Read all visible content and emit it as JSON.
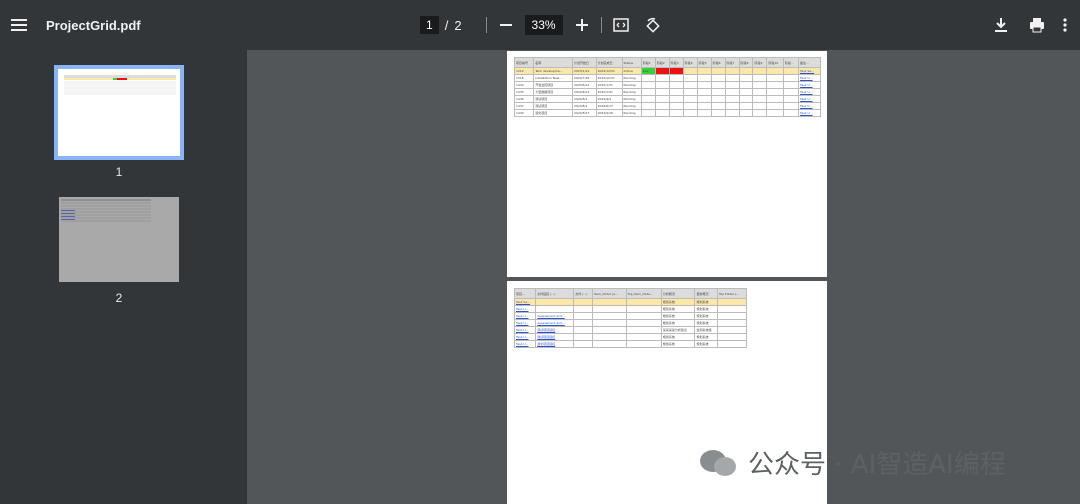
{
  "toolbar": {
    "title": "ProjectGrid.pdf",
    "current_page": "1",
    "page_separator": "/",
    "total_pages": "2",
    "zoom": "33%"
  },
  "sidebar": {
    "thumbnails": [
      {
        "label": "1"
      },
      {
        "label": "2"
      }
    ]
  },
  "page1_table": {
    "headers": [
      "项目编号",
      "名称",
      "计划开始日",
      "计划完成日",
      "Status",
      "阶段1",
      "阶段2",
      "阶段3",
      "阶段4",
      "阶段5",
      "阶段6",
      "阶段7",
      "阶段8",
      "阶段9",
      "阶段10",
      "阶段...",
      "备注..."
    ],
    "rows": [
      [
        "1212",
        "Tank developme...",
        "2023/1/21",
        "2024/12/31",
        "Active",
        "Low",
        "",
        "",
        "",
        "",
        "",
        "",
        "",
        "",
        "",
        "",
        "Task Se..."
      ],
      [
        "1316",
        "Installation New...",
        "2024/7/26",
        "2024/12/31",
        "Pending",
        "",
        "",
        "",
        "",
        "",
        "",
        "",
        "",
        "",
        "",
        "",
        "Task U..."
      ],
      [
        "1434",
        "开发监控项目",
        "2024/6/12",
        "2025/1/31",
        "Pending",
        "",
        "",
        "",
        "",
        "",
        "",
        "",
        "",
        "",
        "",
        "",
        "Task U..."
      ],
      [
        "1435",
        "大型数据项目",
        "2024/6/12",
        "2025/1/31",
        "Pending",
        "",
        "",
        "",
        "",
        "",
        "",
        "",
        "",
        "",
        "",
        "",
        "Task U..."
      ],
      [
        "1436",
        "测试项目",
        "2024/8/1",
        "2024/9/4",
        "Pending",
        "",
        "",
        "",
        "",
        "",
        "",
        "",
        "",
        "",
        "",
        "",
        "Task U..."
      ],
      [
        "1437",
        "测试项目",
        "2024/8/1",
        "2024/9/17",
        "Pending",
        "",
        "",
        "",
        "",
        "",
        "",
        "",
        "",
        "",
        "",
        "",
        "Task U..."
      ],
      [
        "1439",
        "退化项目",
        "2024/8/17",
        "2024/9/26",
        "Pending",
        "",
        "",
        "",
        "",
        "",
        "",
        "",
        "",
        "",
        "",
        "",
        "Task U..."
      ]
    ]
  },
  "page2_table": {
    "headers": [
      "项目...",
      "文件链接 (...)",
      "文件 (...)",
      "Item_folder (a...",
      "Top_Item_folde...",
      "分析概况",
      "更新概况",
      "Top Folder (..."
    ],
    "rows": [
      [
        "Task Se...",
        "",
        "",
        "",
        "",
        "规划系统",
        "规划系统",
        ""
      ],
      [
        "Task U...",
        "",
        "",
        "",
        "",
        "规划系统",
        "规划系统",
        ""
      ],
      [
        "Task U...",
        "Assessment and...",
        "",
        "",
        "",
        "规划系统",
        "规划系统",
        ""
      ],
      [
        "Task U...",
        "Assessment and...",
        "",
        "",
        "",
        "规划系统",
        "规划系统",
        ""
      ],
      [
        "Task U...",
        "测试项目链接",
        "",
        "",
        "",
        "某某某某分析建议",
        "监测系统组",
        ""
      ],
      [
        "Task U...",
        "测试项目链接",
        "",
        "",
        "",
        "规划系统",
        "规划系统",
        ""
      ],
      [
        "Task U...",
        "退化项目链接",
        "",
        "",
        "",
        "规划系统",
        "规划系统",
        ""
      ]
    ]
  },
  "watermark": {
    "text": "公众号 · AI智造AI编程"
  }
}
